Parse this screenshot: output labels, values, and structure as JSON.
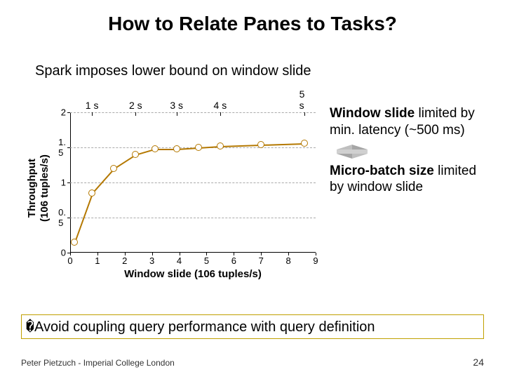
{
  "title": "How to Relate Panes to Tasks?",
  "subtitle": "Spark imposes lower bound on window slide",
  "note1_bold": "Window slide",
  "note1_rest": " limited by min. latency (~500 ms)",
  "note2_bold": "Micro-batch size",
  "note2_rest": " limited by window slide",
  "callout_prefix": "�",
  "callout_text": "Avoid coupling query performance with query definition",
  "footer_left": "Peter Pietzuch - Imperial College London",
  "footer_right": "24",
  "chart_data": {
    "type": "line",
    "title": "",
    "xlabel": "Window slide (106 tuples/s)",
    "ylabel": "Throughput\n(106 tuples/s)",
    "xlim": [
      0,
      9
    ],
    "ylim": [
      0,
      2
    ],
    "xticks": [
      0,
      1,
      2,
      3,
      4,
      5,
      6,
      7,
      8,
      9
    ],
    "yticks": [
      0,
      0.5,
      1,
      1.5,
      2
    ],
    "top_axis": [
      {
        "x": 0.8,
        "label": "1 s"
      },
      {
        "x": 2.4,
        "label": "2 s"
      },
      {
        "x": 3.9,
        "label": "3 s"
      },
      {
        "x": 5.5,
        "label": "4 s"
      },
      {
        "x": 8.6,
        "label": "5 s"
      }
    ],
    "series": [
      {
        "name": "throughput",
        "color": "#b47800",
        "points": [
          {
            "x": 0.15,
            "y": 0.15
          },
          {
            "x": 0.8,
            "y": 0.85
          },
          {
            "x": 1.6,
            "y": 1.2
          },
          {
            "x": 2.4,
            "y": 1.4
          },
          {
            "x": 3.1,
            "y": 1.48
          },
          {
            "x": 3.9,
            "y": 1.48
          },
          {
            "x": 4.7,
            "y": 1.5
          },
          {
            "x": 5.5,
            "y": 1.52
          },
          {
            "x": 7.0,
            "y": 1.54
          },
          {
            "x": 8.6,
            "y": 1.56
          }
        ]
      }
    ]
  }
}
